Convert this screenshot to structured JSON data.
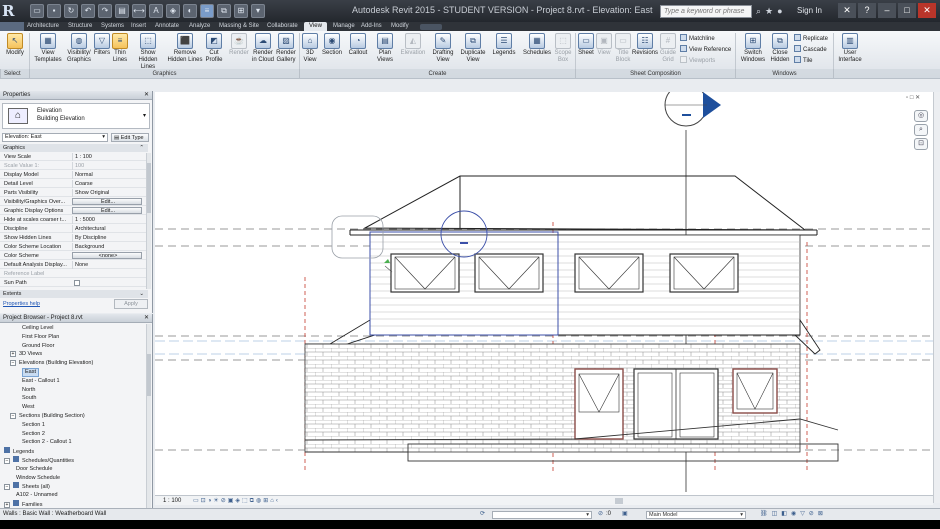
{
  "titlebar": {
    "app_title": "Autodesk Revit 2015 - STUDENT VERSION - Project 8.rvt - Elevation: East",
    "search_placeholder": "Type a keyword or phrase",
    "sign_in": "Sign In"
  },
  "tabs": [
    "Architecture",
    "Structure",
    "Systems",
    "Insert",
    "Annotate",
    "Analyze",
    "Massing & Site",
    "Collaborate",
    "View",
    "Manage",
    "Add-Ins",
    "Modify"
  ],
  "active_tab": "View",
  "ribbon": {
    "modify": "Modify",
    "select": "Select",
    "graphics": {
      "label": "Graphics",
      "buttons": [
        "View Templates",
        "Visibility/ Graphics",
        "Filters",
        "Thin Lines",
        "Show Hidden Lines",
        "Remove Hidden Lines",
        "Cut Profile"
      ]
    },
    "presentation": {
      "buttons": [
        "Render",
        "Render in Cloud",
        "Render Gallery"
      ]
    },
    "create": {
      "label": "Create",
      "buttons": [
        "3D View",
        "Section",
        "Callout",
        "Plan Views",
        "Elevation",
        "Drafting View",
        "Duplicate View",
        "Legends",
        "Schedules",
        "Scope Box"
      ]
    },
    "sheet_composition": {
      "label": "Sheet Composition",
      "buttons": [
        "Sheet",
        "View",
        "Title Block",
        "Revisions",
        "Guide Grid"
      ],
      "small": [
        "Matchline",
        "View Reference",
        "Viewports"
      ]
    },
    "windows": {
      "label": "Windows",
      "buttons": [
        "Switch Windows",
        "Close Hidden"
      ],
      "small": [
        "Replicate",
        "Cascade",
        "Tile"
      ]
    },
    "user_interface": "User Interface"
  },
  "properties": {
    "title": "Properties",
    "type_name": "Elevation",
    "type_sub": "Building Elevation",
    "selector": "Elevation: East",
    "edit_type": "Edit Type",
    "group_graphics": "Graphics",
    "rows": [
      {
        "k": "View Scale",
        "v": "1 : 100"
      },
      {
        "k": "Scale Value   1:",
        "v": "100",
        "grey": true
      },
      {
        "k": "Display Model",
        "v": "Normal"
      },
      {
        "k": "Detail Level",
        "v": "Coarse"
      },
      {
        "k": "Parts Visibility",
        "v": "Show Original"
      },
      {
        "k": "Visibility/Graphics Over...",
        "v": "Edit...",
        "btn": true
      },
      {
        "k": "Graphic Display Options",
        "v": "Edit...",
        "btn": true
      },
      {
        "k": "Hide at scales coarser t...",
        "v": "1 : 5000"
      },
      {
        "k": "Discipline",
        "v": "Architectural"
      },
      {
        "k": "Show Hidden Lines",
        "v": "By Discipline"
      },
      {
        "k": "Color Scheme Location",
        "v": "Background"
      },
      {
        "k": "Color Scheme",
        "v": "<none>",
        "btn": true
      },
      {
        "k": "Default Analysis Display...",
        "v": "None"
      },
      {
        "k": "Reference Label",
        "v": "",
        "grey": true
      },
      {
        "k": "Sun Path",
        "v": ""
      }
    ],
    "group_extents": "Extents",
    "help_link": "Properties help",
    "apply": "Apply"
  },
  "project_browser": {
    "title": "Project Browser - Project 8.rvt",
    "items": [
      {
        "label": "Ceiling Level",
        "indent": 3
      },
      {
        "label": "First Floor Plan",
        "indent": 3
      },
      {
        "label": "Ground Floor",
        "indent": 3
      },
      {
        "label": "3D Views",
        "indent": 1,
        "plus": "+"
      },
      {
        "label": "Elevations (Building Elevation)",
        "indent": 1,
        "plus": "-"
      },
      {
        "label": "East",
        "indent": 3,
        "selected": true
      },
      {
        "label": "East - Callout 1",
        "indent": 3
      },
      {
        "label": "North",
        "indent": 3
      },
      {
        "label": "South",
        "indent": 3
      },
      {
        "label": "West",
        "indent": 3
      },
      {
        "label": "Sections (Building Section)",
        "indent": 1,
        "plus": "-"
      },
      {
        "label": "Section 1",
        "indent": 3
      },
      {
        "label": "Section 2",
        "indent": 3
      },
      {
        "label": "Section 2 - Callout 1",
        "indent": 3
      },
      {
        "label": "Legends",
        "indent": 0,
        "icon": true
      },
      {
        "label": "Schedules/Quantities",
        "indent": 0,
        "icon": true,
        "plus": "-"
      },
      {
        "label": "Door Schedule",
        "indent": 2
      },
      {
        "label": "Window Schedule",
        "indent": 2
      },
      {
        "label": "Sheets (all)",
        "indent": 0,
        "icon": true,
        "plus": "-"
      },
      {
        "label": "A102 - Unnamed",
        "indent": 2
      },
      {
        "label": "Families",
        "indent": 0,
        "icon": true,
        "plus": "+"
      }
    ]
  },
  "viewbar": {
    "scale": "1 : 100"
  },
  "statusbar": {
    "message": "Walls : Basic Wall : Weatherboard Wall",
    "zero": ":0",
    "model": "Main Model"
  },
  "colors": {
    "accent": "#1e4f9c",
    "selection": "#3b4fa8",
    "grid_line": "#3a3a3a",
    "ref_line": "#c4392c"
  }
}
